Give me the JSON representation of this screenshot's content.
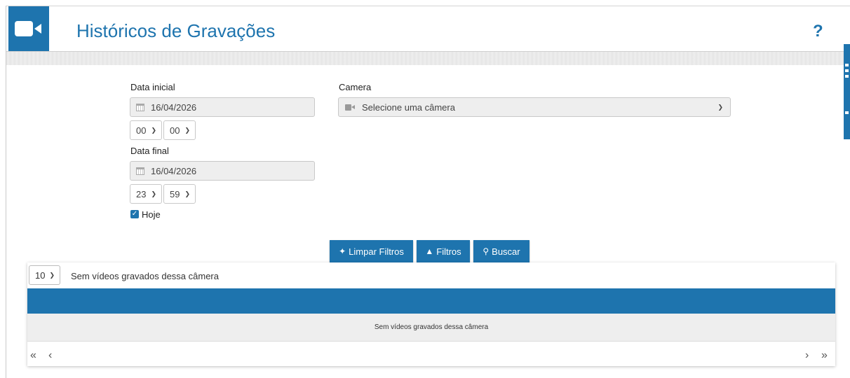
{
  "header": {
    "title": "Históricos de Gravações",
    "help": "?",
    "logo_icon": "video-camera-icon",
    "accent": "#1e74ae"
  },
  "form": {
    "start": {
      "label": "Data inicial",
      "date": "16/04/2026",
      "hour": "00",
      "minute": "00"
    },
    "end": {
      "label": "Data final",
      "date": "16/04/2026",
      "hour": "23",
      "minute": "59"
    },
    "today": {
      "label": "Hoje",
      "checked": true
    },
    "camera": {
      "label": "Camera",
      "placeholder": "Selecione uma câmera"
    }
  },
  "buttons": {
    "clear": "Limpar Filtros",
    "filters": "Filtros",
    "search": "Buscar"
  },
  "table": {
    "page_size": "10",
    "info": "Sem vídeos gravados dessa câmera",
    "empty_message": "Sem vídeos gravados dessa câmera",
    "pager": {
      "first": "«",
      "prev": "‹",
      "next": "›",
      "last": "»"
    }
  }
}
